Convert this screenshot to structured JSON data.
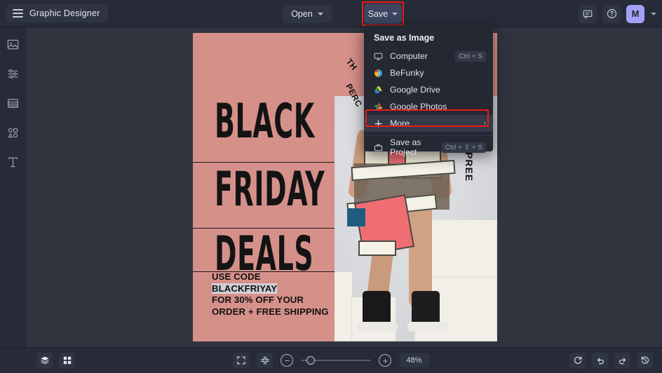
{
  "app": {
    "title": "Graphic Designer",
    "menu_icon": "hamburger-icon"
  },
  "topbar": {
    "open_label": "Open",
    "save_label": "Save",
    "comment_icon": "comment-icon",
    "help_icon": "help-circle-icon",
    "avatar_initial": "M",
    "avatar_color": "#a3a0f7",
    "highlight_color": "#ee1b13"
  },
  "sidebar": {
    "items": [
      {
        "name": "image-icon",
        "label": "Image"
      },
      {
        "name": "sliders-icon",
        "label": "Edit"
      },
      {
        "name": "frames-icon",
        "label": "Templates"
      },
      {
        "name": "shapes-icon",
        "label": "Graphics"
      },
      {
        "name": "text-icon",
        "label": "Text"
      }
    ]
  },
  "save_menu": {
    "heading": "Save as Image",
    "items": [
      {
        "label": "Computer",
        "icon": "monitor-icon",
        "shortcut": "Ctrl + S",
        "active": false
      },
      {
        "label": "BeFunky",
        "icon": "befunky-logo-icon",
        "shortcut": "",
        "active": false
      },
      {
        "label": "Google Drive",
        "icon": "google-drive-icon",
        "shortcut": "",
        "active": false
      },
      {
        "label": "Google Photos",
        "icon": "google-photos-icon",
        "shortcut": "",
        "active": false
      },
      {
        "label": "More",
        "icon": "plus-icon",
        "shortcut": "",
        "active": true
      }
    ],
    "project_item": {
      "label": "Save as Project",
      "icon": "briefcase-icon",
      "shortcut": "Ctrl + ⇧ + S"
    }
  },
  "canvas": {
    "poster": {
      "background_color": "#d6908a",
      "headline_lines": [
        "BLACK",
        "FRIDAY",
        "DEALS"
      ],
      "promo_line1": "USE CODE",
      "promo_code": "BLACKFRIYAY",
      "promo_line3": "FOR 30% OFF YOUR",
      "promo_line4": "ORDER + FREE SHIPPING",
      "curved_text_1": "TH",
      "curved_text_2": "PERC",
      "vertical_text": "PREE"
    }
  },
  "bottombar": {
    "layers_icon": "layers-icon",
    "grid_icon": "grid-icon",
    "fullscreen_icon": "expand-icon",
    "fit_icon": "collapse-icon",
    "zoom_out_icon": "minus-circle-icon",
    "zoom_in_icon": "plus-circle-icon",
    "zoom_level": "48%",
    "zoom_slider_value": 48,
    "reset_icon": "reset-icon",
    "undo_icon": "undo-icon",
    "redo_icon": "redo-icon",
    "history_icon": "history-icon"
  }
}
